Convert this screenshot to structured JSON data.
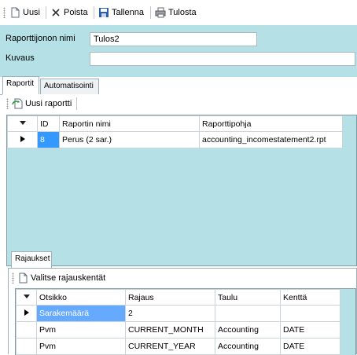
{
  "toolbar": {
    "new_label": "Uusi",
    "delete_label": "Poista",
    "save_label": "Tallenna",
    "print_label": "Tulosta"
  },
  "form": {
    "name_label": "Raporttijonon nimi",
    "name_value": "Tulos2",
    "description_label": "Kuvaus",
    "description_value": ""
  },
  "tabs": [
    {
      "label": "Raportit",
      "active": true
    },
    {
      "label": "Automatisointi",
      "active": false
    }
  ],
  "reports": {
    "new_report_label": "Uusi raportti",
    "columns": [
      "ID",
      "Raportin nimi",
      "Raporttipohja"
    ],
    "rows": [
      {
        "id": "8",
        "name": "Perus (2 sar.)",
        "template": "accounting_incomestatement2.rpt"
      }
    ]
  },
  "restrictions": {
    "group_label": "Rajaukset",
    "select_fields_label": "Valitse rajauskentät",
    "columns": [
      "Otsikko",
      "Rajaus",
      "Taulu",
      "Kenttä"
    ],
    "rows": [
      {
        "title": "Sarakemäärä",
        "restriction": "2",
        "table": "",
        "field": ""
      },
      {
        "title": "Pvm",
        "restriction": "CURRENT_MONTH",
        "table": "Accounting",
        "field": "DATE"
      },
      {
        "title": "Pvm",
        "restriction": "CURRENT_YEAR",
        "table": "Accounting",
        "field": "DATE"
      }
    ]
  },
  "colors": {
    "panel": "#b4e0e6",
    "selection": "#3399ff"
  }
}
